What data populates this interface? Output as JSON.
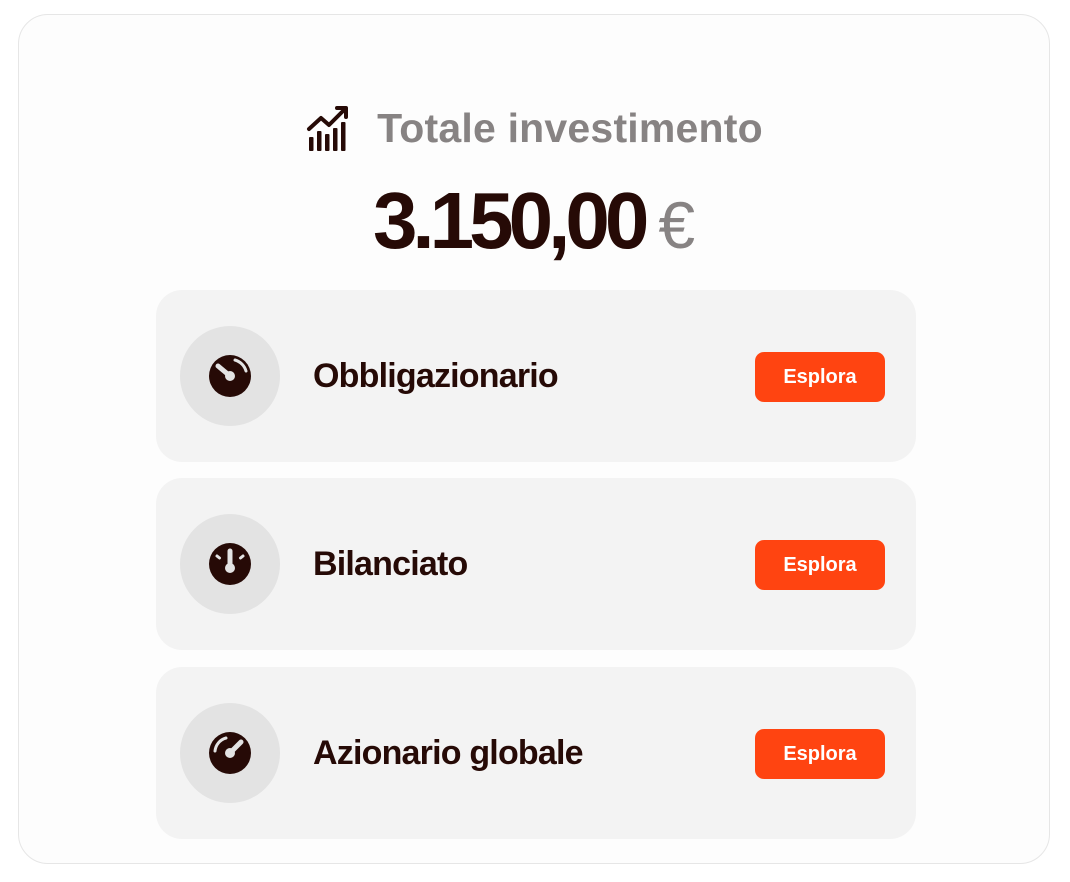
{
  "header": {
    "icon": "chart-trending-up-icon",
    "title": "Totale investimento"
  },
  "total": {
    "amount": "3.150,00",
    "currency": "€"
  },
  "funds": [
    {
      "name": "Obbligazionario",
      "icon": "gauge-low-icon",
      "button_label": "Esplora"
    },
    {
      "name": "Bilanciato",
      "icon": "gauge-medium-icon",
      "button_label": "Esplora"
    },
    {
      "name": "Azionario globale",
      "icon": "gauge-high-icon",
      "button_label": "Esplora"
    }
  ],
  "colors": {
    "accent": "#ff4411",
    "text_dark": "#260a06",
    "text_muted": "#878383",
    "row_bg": "#f3f3f3",
    "icon_circle_bg": "#e3e3e3"
  }
}
